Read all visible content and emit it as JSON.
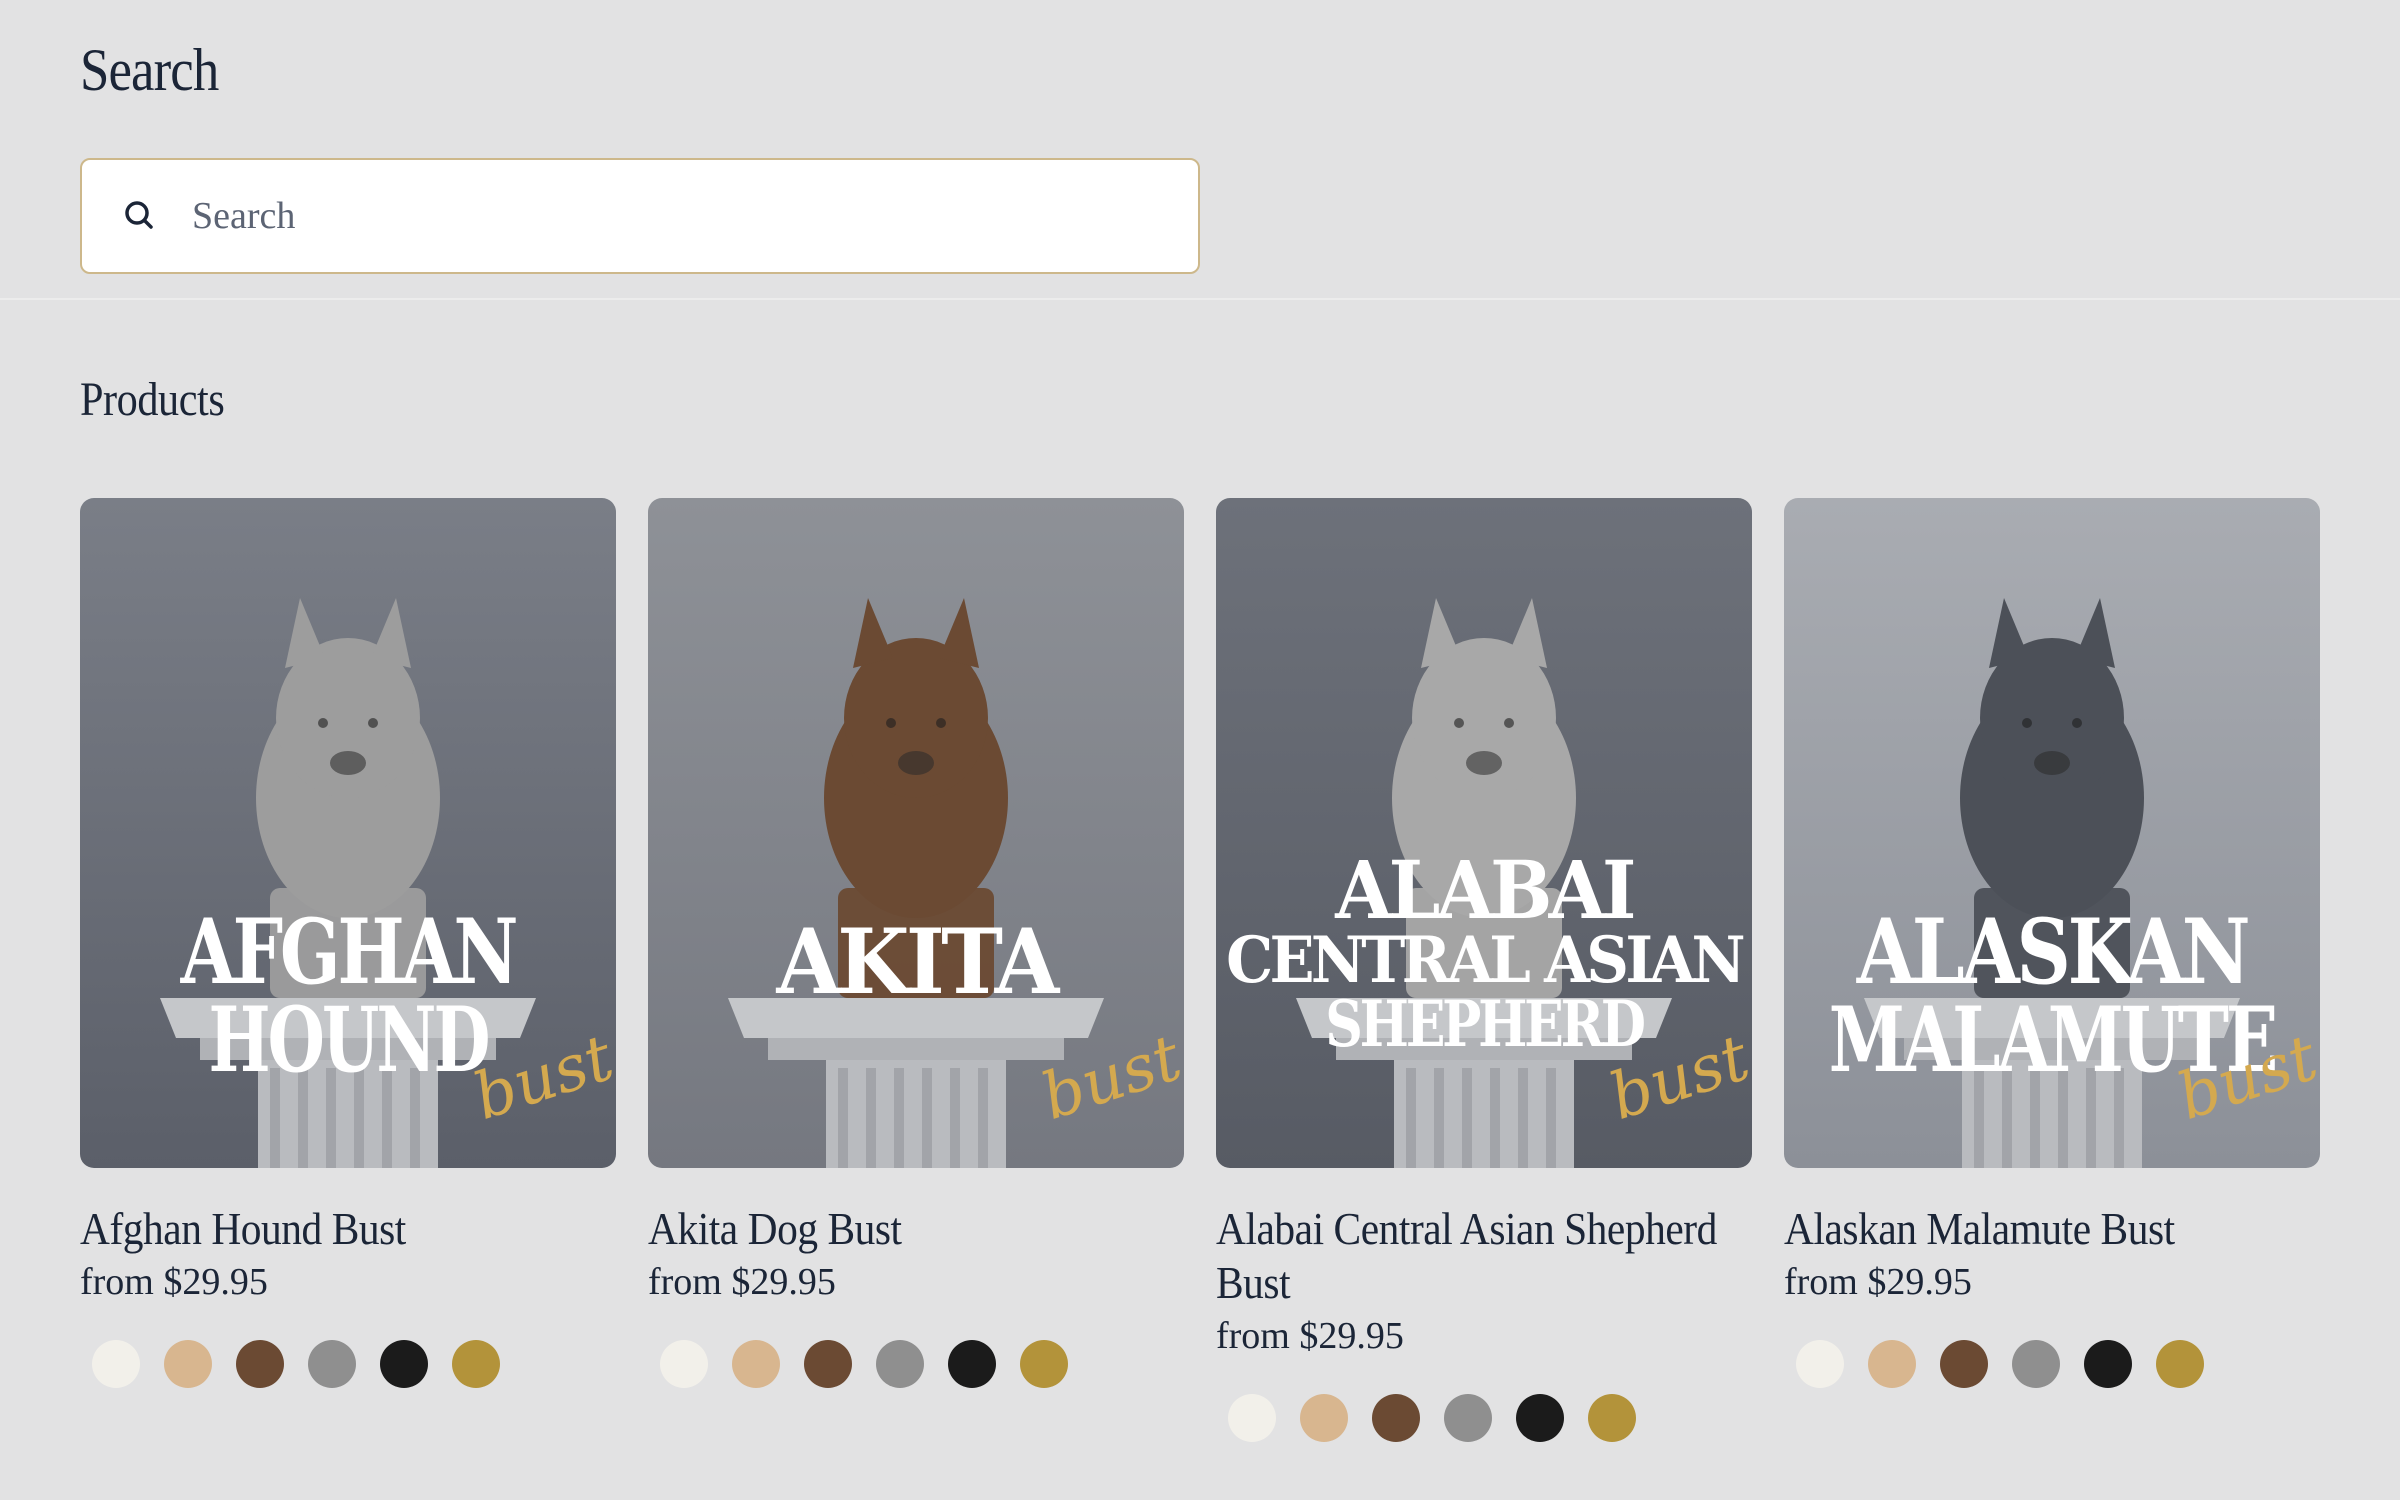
{
  "search": {
    "heading": "Search",
    "placeholder": "Search",
    "icon": "search-icon"
  },
  "products": {
    "heading": "Products",
    "items": [
      {
        "title": "Afghan Hound Bust",
        "price": "from $29.95",
        "image_lines": [
          "AFGHAN",
          "HOUND"
        ],
        "image_script": "bust",
        "bust_color": "#9d9d9d"
      },
      {
        "title": "Akita Dog Bust",
        "price": "from $29.95",
        "image_lines": [
          "AKITA"
        ],
        "image_script": "bust",
        "bust_color": "#6b4a33"
      },
      {
        "title": "Alabai Central Asian Shepherd Bust",
        "price": "from $29.95",
        "image_lines": [
          "ALABAI",
          "CENTRAL ASIAN",
          "SHEPHERD"
        ],
        "image_script": "bust",
        "bust_color": "#a8a8a8"
      },
      {
        "title": "Alaskan Malamute Bust",
        "price": "from $29.95",
        "image_lines": [
          "ALASKAN",
          "MALAMUTE"
        ],
        "image_script": "bust",
        "bust_color": "#4c5058"
      }
    ],
    "swatches": [
      {
        "name": "white",
        "color": "#f2f0ea"
      },
      {
        "name": "beige",
        "color": "#d8b68f"
      },
      {
        "name": "brown",
        "color": "#6b4a33"
      },
      {
        "name": "grey",
        "color": "#8f8f8f"
      },
      {
        "name": "black",
        "color": "#1b1b1b"
      },
      {
        "name": "gold",
        "color": "#b3933a"
      }
    ]
  },
  "colors": {
    "background": "#e2e2e3",
    "text": "#1b2537",
    "search_border": "#cdb88b",
    "script_gold": "#d4a94f"
  }
}
